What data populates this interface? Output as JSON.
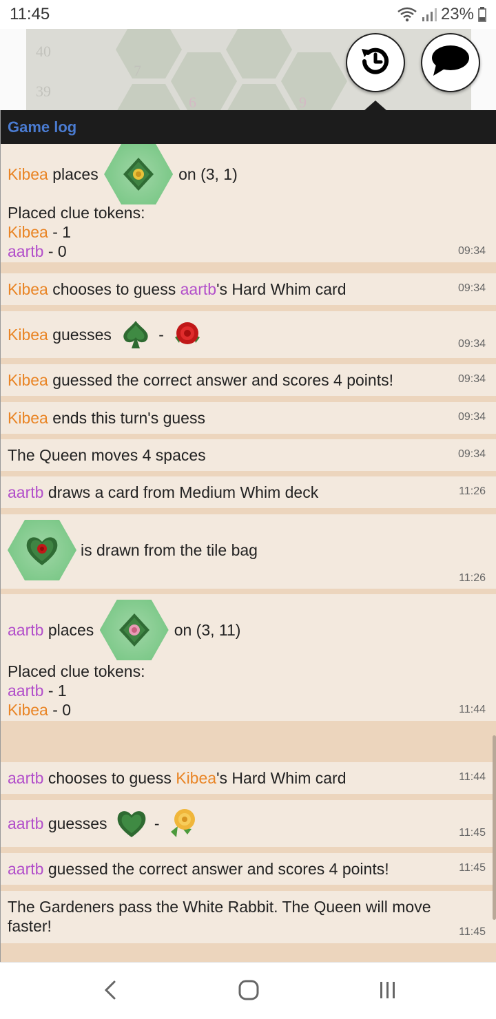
{
  "status_bar": {
    "time": "11:45",
    "battery": "23%"
  },
  "board": {
    "numbers": [
      "40",
      "39",
      "7",
      "6",
      "9"
    ]
  },
  "panel": {
    "title": "Game log"
  },
  "colors": {
    "player_kibea": "#e98526",
    "player_aartb": "#b24fca",
    "title_blue": "#4a7bd0"
  },
  "log": {
    "e1": {
      "player": "Kibea",
      "verb": " places ",
      "tail": "on (3, 1)",
      "clue_label": "Placed clue tokens:",
      "clue1_player": "Kibea",
      "clue1_val": " - 1",
      "clue2_player": "aartb",
      "clue2_val": " - 0",
      "time": "09:34"
    },
    "e2": {
      "player": "Kibea",
      "text1": " chooses to guess ",
      "target": "aartb",
      "text2": "'s Hard Whim card",
      "time": "09:34"
    },
    "e3": {
      "player": "Kibea",
      "verb": " guesses ",
      "sep": "-",
      "time": "09:34"
    },
    "e4": {
      "player": "Kibea",
      "text": " guessed the correct answer and scores 4 points!",
      "time": "09:34"
    },
    "e5": {
      "player": "Kibea",
      "text": " ends this turn's guess",
      "time": "09:34"
    },
    "e6": {
      "text": "The Queen moves 4 spaces",
      "time": "09:34"
    },
    "e7": {
      "player": "aartb",
      "text": " draws a card from Medium Whim deck",
      "time": "11:26"
    },
    "e8": {
      "text": "is drawn from the tile bag",
      "time": "11:26"
    },
    "e9": {
      "player": "aartb",
      "verb": " places ",
      "tail": "on (3, 11)",
      "clue_label": "Placed clue tokens:",
      "clue1_player": "aartb",
      "clue1_val": " - 1",
      "clue2_player": "Kibea",
      "clue2_val": " - 0",
      "time": "11:44"
    },
    "e10": {
      "player": "aartb",
      "text1": " chooses to guess ",
      "target": "Kibea",
      "text2": "'s Hard Whim card",
      "time": "11:44"
    },
    "e11": {
      "player": "aartb",
      "verb": " guesses ",
      "sep": "-",
      "time": "11:45"
    },
    "e12": {
      "player": "aartb",
      "text": " guessed the correct answer and scores 4 points!",
      "time": "11:45"
    },
    "e13": {
      "text": "The Gardeners pass the White Rabbit. The Queen will move faster!",
      "time": "11:45"
    }
  },
  "icons": {
    "history": "history-icon",
    "chat": "chat-bubble-icon",
    "tiles": [
      "yellow-rose-diamond-tile",
      "pink-rose-diamond-tile",
      "red-rose-heart-tile"
    ],
    "guesses": [
      "spade-hedge",
      "red-rose",
      "heart-hedge",
      "yellow-rose"
    ]
  }
}
